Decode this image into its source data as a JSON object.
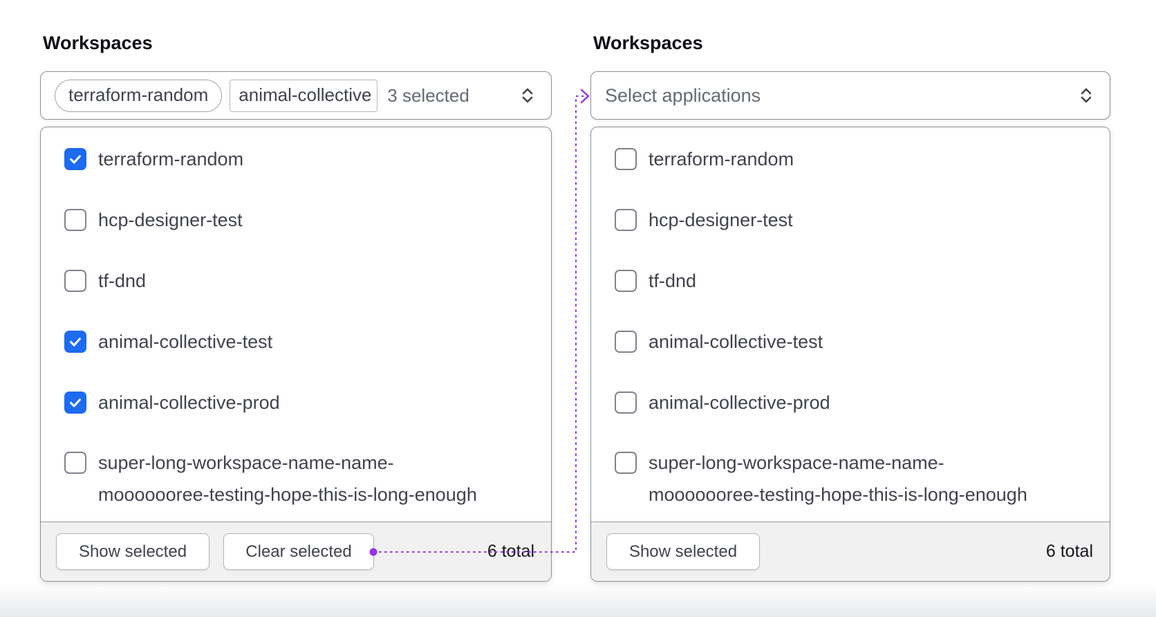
{
  "panels": [
    {
      "label": "Workspaces",
      "trigger": {
        "tags": [
          "terraform-random",
          "animal-collective"
        ],
        "count_text": "3 selected"
      },
      "options": [
        {
          "label": "terraform-random",
          "checked": true
        },
        {
          "label": "hcp-designer-test",
          "checked": false
        },
        {
          "label": "tf-dnd",
          "checked": false
        },
        {
          "label": "animal-collective-test",
          "checked": true
        },
        {
          "label": "animal-collective-prod",
          "checked": true
        },
        {
          "label": "super-long-workspace-name-name-mooooooree-testing-hope-this-is-long-enough",
          "label_lines": [
            "super-long-workspace-name-name-",
            "mooooooree-testing-hope-this-is-long-enough"
          ],
          "checked": false
        }
      ],
      "footer": {
        "show_selected_label": "Show selected",
        "clear_selected_label": "Clear selected",
        "total_text": "6 total"
      }
    },
    {
      "label": "Workspaces",
      "trigger": {
        "placeholder": "Select applications"
      },
      "options": [
        {
          "label": "terraform-random",
          "checked": false
        },
        {
          "label": "hcp-designer-test",
          "checked": false
        },
        {
          "label": "tf-dnd",
          "checked": false
        },
        {
          "label": "animal-collective-test",
          "checked": false
        },
        {
          "label": "animal-collective-prod",
          "checked": false
        },
        {
          "label": "super-long-workspace-name-name-mooooooree-testing-hope-this-is-long-enough",
          "label_lines": [
            "super-long-workspace-name-name-",
            "mooooooree-testing-hope-this-is-long-enough"
          ],
          "checked": false
        }
      ],
      "footer": {
        "show_selected_label": "Show selected",
        "total_text": "6 total"
      }
    }
  ],
  "colors": {
    "checkbox_checked": "#1c6bf0",
    "annotation_purple": "#9333ea",
    "panel_border": "#8a8e98",
    "footer_bg": "#f1f1f2",
    "text_primary": "#40434d",
    "text_faint": "#646a75"
  },
  "icons": {
    "trigger_chevron": "unfold-chevron-icon",
    "checkbox_check": "checkmark-icon"
  }
}
